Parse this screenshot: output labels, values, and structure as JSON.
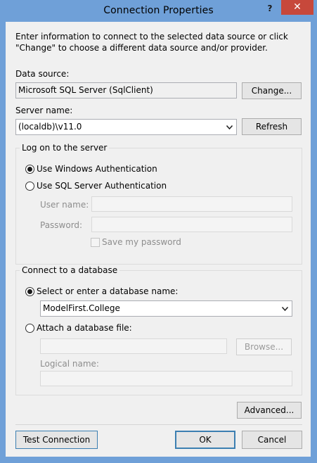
{
  "window": {
    "title": "Connection Properties",
    "help_glyph": "?",
    "close_glyph": "✕"
  },
  "intro": "Enter information to connect to the selected data source or click \"Change\" to choose a different data source and/or provider.",
  "data_source": {
    "label": "Data source:",
    "value": "Microsoft SQL Server (SqlClient)",
    "change_button": "Change..."
  },
  "server": {
    "label": "Server name:",
    "value": "(localdb)\\v11.0",
    "refresh_button": "Refresh"
  },
  "logon": {
    "group_title": "Log on to the server",
    "windows_auth": "Use Windows Authentication",
    "windows_auth_selected": true,
    "sql_auth": "Use SQL Server Authentication",
    "sql_auth_selected": false,
    "username_label": "User name:",
    "username_value": "",
    "password_label": "Password:",
    "password_value": "",
    "save_password_label": "Save my password",
    "save_password_checked": false
  },
  "database": {
    "group_title": "Connect to a database",
    "select_label": "Select or enter a database name:",
    "select_selected": true,
    "database_value": "ModelFirst.College",
    "attach_label": "Attach a database file:",
    "attach_selected": false,
    "attach_value": "",
    "browse_button": "Browse...",
    "logical_name_label": "Logical name:",
    "logical_name_value": ""
  },
  "buttons": {
    "advanced": "Advanced...",
    "test_connection": "Test Connection",
    "ok": "OK",
    "cancel": "Cancel"
  },
  "icons": {
    "dropdown": "chevron-down-icon",
    "close": "close-icon",
    "help": "help-icon"
  },
  "colors": {
    "titlebar": "#6fa0d8",
    "close_button": "#c7483b",
    "client_background": "#f0f0f0",
    "default_button_border": "#3c7fb1"
  }
}
